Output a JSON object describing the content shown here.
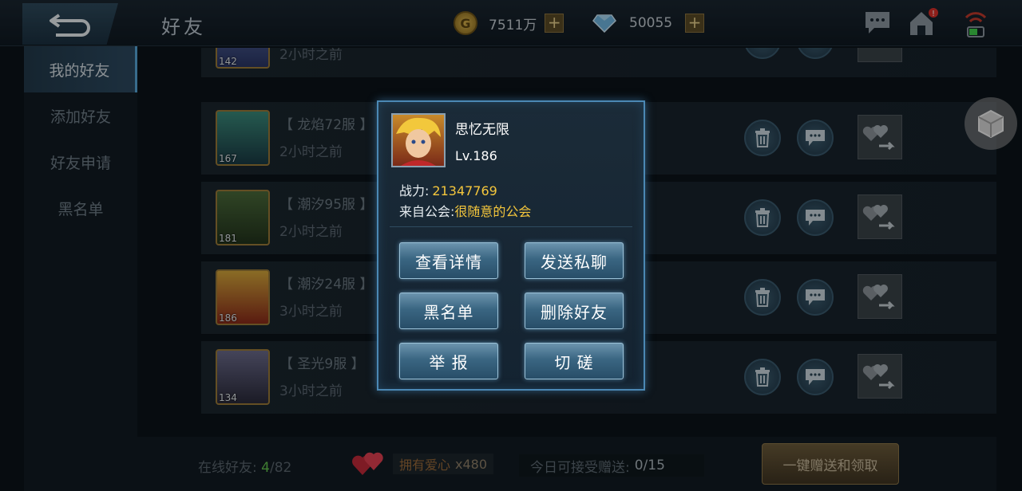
{
  "header": {
    "title": "好友",
    "gold": {
      "value": "7511万",
      "icon": "gold-coin-icon"
    },
    "diamond": {
      "value": "50055",
      "icon": "diamond-icon"
    },
    "plus_label": "+"
  },
  "sidebar": {
    "items": [
      {
        "label": "我的好友",
        "active": true
      },
      {
        "label": "添加好友",
        "active": false
      },
      {
        "label": "好友申请",
        "active": false
      },
      {
        "label": "黑名单",
        "active": false
      }
    ]
  },
  "friends": [
    {
      "level": "142",
      "server": "",
      "time": "2小时之前"
    },
    {
      "level": "167",
      "server": "【 龙焰72服 】",
      "time": "2小时之前"
    },
    {
      "level": "181",
      "server": "【 潮汐95服 】",
      "time": "2小时之前"
    },
    {
      "level": "186",
      "server": "【 潮汐24服 】",
      "time": "3小时之前"
    },
    {
      "level": "134",
      "server": "【 圣光9服 】",
      "time": "3小时之前"
    }
  ],
  "bottom": {
    "online_label": "在线好友:",
    "online_count": "4",
    "online_total": "/82",
    "hearts_label": "拥有爱心",
    "hearts_count": "x480",
    "receive_label": "今日可接受赠送:",
    "receive_count": "0/15",
    "one_key_label": "一键赠送和领取"
  },
  "popup": {
    "name": "思忆无限",
    "level": "Lv.186",
    "power_label": "战力:",
    "power_value": "21347769",
    "guild_label": "来自公会:",
    "guild_value": "很随意的公会",
    "buttons": {
      "view_details": "查看详情",
      "send_message": "发送私聊",
      "blacklist": "黑名单",
      "delete_friend": "删除好友",
      "report": "举 报",
      "spar": "切 磋"
    }
  },
  "colors": {
    "accent_gold": "#f4c63c",
    "online_green": "#62c04e",
    "popup_border": "#4b88b4"
  }
}
